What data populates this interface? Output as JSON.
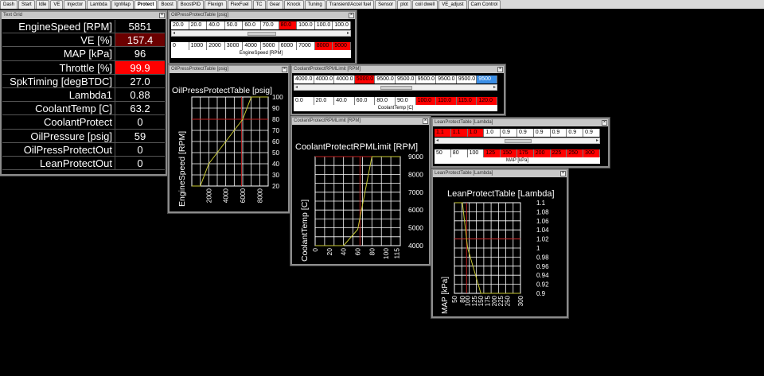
{
  "tabs": [
    "Dash",
    "Start",
    "Idle",
    "VE",
    "Injector",
    "Lambda",
    "IgnMap",
    "Protect",
    "Boost",
    "BoostPID",
    "Flexign",
    "FlexFuel",
    "TC",
    "Gear",
    "Knock",
    "Tuning",
    "Transient/Accel fuel",
    "Sensor",
    "plot",
    "coil dwell",
    "VE_adjust",
    "Cam Control"
  ],
  "active_tab": "Protect",
  "text_grid": {
    "title": "Text Grid",
    "rows": [
      {
        "label": "EngineSpeed [RPM]",
        "value": "5851",
        "highlight": "none"
      },
      {
        "label": "VE [%]",
        "value": "157.4",
        "highlight": "darkred"
      },
      {
        "label": "MAP [kPa]",
        "value": "96",
        "highlight": "none"
      },
      {
        "label": "Throttle [%]",
        "value": "99.9",
        "highlight": "red"
      },
      {
        "label": "SpkTiming [degBTDC]",
        "value": "27.0",
        "highlight": "none"
      },
      {
        "label": "Lambda1",
        "value": "0.88",
        "highlight": "none"
      },
      {
        "label": "CoolantTemp [C]",
        "value": "63.2",
        "highlight": "none"
      },
      {
        "label": "CoolantProtect",
        "value": "0",
        "highlight": "none"
      },
      {
        "label": "OilPressure [psig]",
        "value": "59",
        "highlight": "none"
      },
      {
        "label": "OilPressProtectOut",
        "value": "0",
        "highlight": "none"
      },
      {
        "label": "LeanProtectOut",
        "value": "0",
        "highlight": "none"
      }
    ]
  },
  "oil_table": {
    "title": "OilPressProtectTable [psig]",
    "values": [
      "20.0",
      "20.0",
      "40.0",
      "50.0",
      "60.0",
      "70.0",
      "80.0",
      "100.0",
      "100.0",
      "100.0"
    ],
    "hot_values": [
      false,
      false,
      false,
      false,
      false,
      false,
      true,
      false,
      false,
      false
    ],
    "axis": [
      "0",
      "1000",
      "2000",
      "3000",
      "4000",
      "5000",
      "6000",
      "7000",
      "8000",
      "9000"
    ],
    "hot_axis": [
      false,
      false,
      false,
      false,
      false,
      false,
      false,
      false,
      true,
      true
    ],
    "axis_label": "EngineSpeed [RPM]"
  },
  "oil_chart": {
    "window_title": "OilPressProtectTable [psig]",
    "chart_data": {
      "type": "line",
      "title": "OilPressProtectTable [psig]",
      "xlabel": "EngineSpeed [RPM]",
      "x": [
        0,
        1000,
        2000,
        3000,
        4000,
        5000,
        6000,
        7000,
        8000,
        9000
      ],
      "y": [
        20,
        20,
        40,
        50,
        60,
        70,
        80,
        100,
        100,
        100
      ],
      "xlim": [
        0,
        9000
      ],
      "ylim": [
        20,
        100
      ],
      "x_ticks": [
        "2000",
        "4000",
        "6000",
        "8000"
      ],
      "y_ticks": [
        "100",
        "90",
        "80",
        "70",
        "60",
        "50",
        "40",
        "30",
        "20"
      ],
      "marker_x": 5851,
      "marker_y": 80,
      "grid": true
    }
  },
  "coolant_table": {
    "title": "CoolantProtectRPMLimit [RPM]",
    "values": [
      "4000.0",
      "4000.0",
      "4000.0",
      "5000.0",
      "9500.0",
      "9500.0",
      "9500.0",
      "9500.0",
      "9500.0",
      "9500"
    ],
    "hot_values": [
      false,
      false,
      false,
      true,
      false,
      false,
      false,
      false,
      false,
      false
    ],
    "sel_index": 9,
    "axis": [
      "0.0",
      "20.0",
      "40.0",
      "60.0",
      "80.0",
      "90.0",
      "100.0",
      "110.0",
      "115.0",
      "120.0"
    ],
    "hot_axis": [
      false,
      false,
      false,
      false,
      false,
      false,
      true,
      true,
      true,
      true
    ],
    "axis_label": "CoolantTemp [C]"
  },
  "coolant_chart": {
    "window_title": "CoolantProtectRPMLimit [RPM]",
    "chart_data": {
      "type": "line",
      "title": "CoolantProtectRPMLimit [RPM]",
      "xlabel": "CoolantTemp [C]",
      "x": [
        0,
        20,
        40,
        60,
        80,
        90,
        100,
        110,
        115,
        120
      ],
      "y": [
        4000,
        4000,
        4000,
        5000,
        9500,
        9500,
        9500,
        9500,
        9500,
        9500
      ],
      "xlim": [
        0,
        120
      ],
      "ylim": [
        4000,
        9500
      ],
      "x_ticks": [
        "0",
        "20",
        "40",
        "60",
        "80",
        "100",
        "115"
      ],
      "y_ticks": [
        "9000",
        "8000",
        "7000",
        "6000",
        "5000",
        "4000"
      ],
      "marker_x": 63.2,
      "marker_y": 9500,
      "grid": true
    }
  },
  "lean_table": {
    "title": "LeanProtectTable [Lambda]",
    "values": [
      "1.1",
      "1.1",
      "1.0",
      "1.0",
      "0.9",
      "0.9",
      "0.9",
      "0.9",
      "0.9",
      "0.9"
    ],
    "hot_values": [
      true,
      true,
      true,
      false,
      false,
      false,
      false,
      false,
      false,
      false
    ],
    "axis": [
      "50",
      "80",
      "100",
      "125",
      "150",
      "175",
      "200",
      "225",
      "250",
      "300"
    ],
    "hot_axis": [
      false,
      false,
      false,
      true,
      true,
      true,
      true,
      true,
      true,
      true
    ],
    "axis_label": "MAP [kPa]"
  },
  "lean_chart": {
    "window_title": "LeanProtectTable [Lambda]",
    "chart_data": {
      "type": "line",
      "title": "LeanProtectTable [Lambda]",
      "xlabel": "MAP [kPa]",
      "x": [
        50,
        80,
        100,
        125,
        150,
        175,
        200,
        225,
        250,
        300
      ],
      "y": [
        1.1,
        1.1,
        1.0,
        0.95,
        0.9,
        0.9,
        0.9,
        0.9,
        0.9,
        0.9
      ],
      "xlim": [
        50,
        300
      ],
      "ylim": [
        0.9,
        1.1
      ],
      "x_ticks": [
        "50",
        "80",
        "100",
        "125",
        "150",
        "175",
        "200",
        "225",
        "250",
        "300"
      ],
      "y_ticks": [
        "1.1",
        "1.08",
        "1.06",
        "1.04",
        "1.02",
        "1",
        "0.98",
        "0.96",
        "0.94",
        "0.92",
        "0.9"
      ],
      "marker_x": 96,
      "marker_y": 1.02,
      "grid": true
    }
  },
  "colors": {
    "hot": "#ff0000",
    "darkred": "#6b0000",
    "select": "#3a8ee6",
    "curve": "#c8c832",
    "marker": "#c02020"
  }
}
